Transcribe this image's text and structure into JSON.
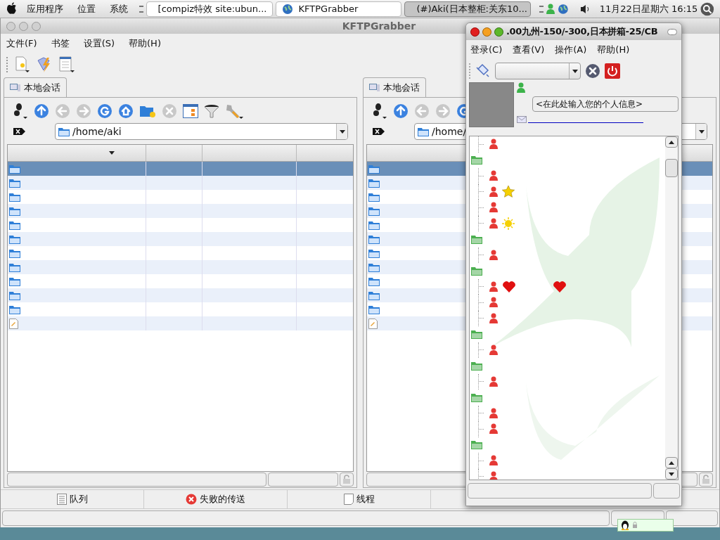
{
  "panel": {
    "menus": [
      "应用程序",
      "位置",
      "系统"
    ],
    "tasks": [
      {
        "label": "[compiz特效 site:ubun...",
        "kind": "browser",
        "selected": false
      },
      {
        "label": "KFTPGrabber",
        "kind": "globe",
        "selected": false
      },
      {
        "label": "(#)Aki(日本整柜:关东10...",
        "kind": "chat",
        "selected": true
      }
    ],
    "clock": "11月22日星期六 16:15"
  },
  "ftp": {
    "title": "KFTPGrabber",
    "menu": [
      "文件(F)",
      "书签",
      "设置(S)",
      "帮助(H)"
    ],
    "panes": [
      {
        "tab": "本地会话",
        "path": "/home/aki",
        "rows": [
          {
            "kind": "folder",
            "selected": true
          },
          {
            "kind": "folder",
            "selected": false
          },
          {
            "kind": "folder",
            "selected": false
          },
          {
            "kind": "folder",
            "selected": false
          },
          {
            "kind": "folder",
            "selected": false
          },
          {
            "kind": "folder",
            "selected": false
          },
          {
            "kind": "folder",
            "selected": false
          },
          {
            "kind": "folder",
            "selected": false
          },
          {
            "kind": "folder",
            "selected": false
          },
          {
            "kind": "folder",
            "selected": false
          },
          {
            "kind": "folder",
            "selected": false
          },
          {
            "kind": "file",
            "selected": false
          }
        ]
      },
      {
        "tab": "本地会话",
        "path": "/home/",
        "rows": [
          {
            "kind": "folder",
            "selected": true
          },
          {
            "kind": "folder",
            "selected": false
          },
          {
            "kind": "folder",
            "selected": false
          },
          {
            "kind": "folder",
            "selected": false
          },
          {
            "kind": "folder",
            "selected": false
          },
          {
            "kind": "folder",
            "selected": false
          },
          {
            "kind": "folder",
            "selected": false
          },
          {
            "kind": "folder",
            "selected": false
          },
          {
            "kind": "folder",
            "selected": false
          },
          {
            "kind": "folder",
            "selected": false
          },
          {
            "kind": "folder",
            "selected": false
          },
          {
            "kind": "file",
            "selected": false
          }
        ]
      }
    ],
    "bottom_tabs": [
      {
        "label": "队列",
        "kind": "list"
      },
      {
        "label": "失败的传送",
        "kind": "error"
      },
      {
        "label": "线程",
        "kind": "page"
      }
    ]
  },
  "qq": {
    "title": ".00九州-150/-300,日本拼箱-25/CB",
    "menu": [
      "登录(C)",
      "查看(V)",
      "操作(A)",
      "帮助(H)"
    ],
    "signature": "<在此处输入您的个人信息>",
    "tree": [
      {
        "kind": "buddy"
      },
      {
        "kind": "group",
        "expanded": true,
        "children": [
          {
            "kind": "buddy"
          },
          {
            "kind": "buddy",
            "badges": [
              {
                "kind": "star"
              }
            ]
          },
          {
            "kind": "buddy"
          },
          {
            "kind": "buddy",
            "badges": [
              {
                "kind": "sun"
              }
            ]
          }
        ]
      },
      {
        "kind": "group",
        "expanded": true,
        "children": [
          {
            "kind": "buddy"
          }
        ]
      },
      {
        "kind": "group",
        "expanded": true,
        "children": [
          {
            "kind": "buddy",
            "badges": [
              {
                "kind": "heart"
              },
              {
                "kind": "heart"
              }
            ]
          },
          {
            "kind": "buddy"
          },
          {
            "kind": "buddy"
          }
        ]
      },
      {
        "kind": "group",
        "expanded": true,
        "children": [
          {
            "kind": "buddy"
          }
        ]
      },
      {
        "kind": "group",
        "expanded": true,
        "children": [
          {
            "kind": "buddy"
          }
        ]
      },
      {
        "kind": "group",
        "expanded": true,
        "children": [
          {
            "kind": "buddy"
          },
          {
            "kind": "buddy"
          }
        ]
      },
      {
        "kind": "group",
        "expanded": true,
        "children": [
          {
            "kind": "buddy"
          },
          {
            "kind": "buddy"
          }
        ]
      }
    ]
  }
}
